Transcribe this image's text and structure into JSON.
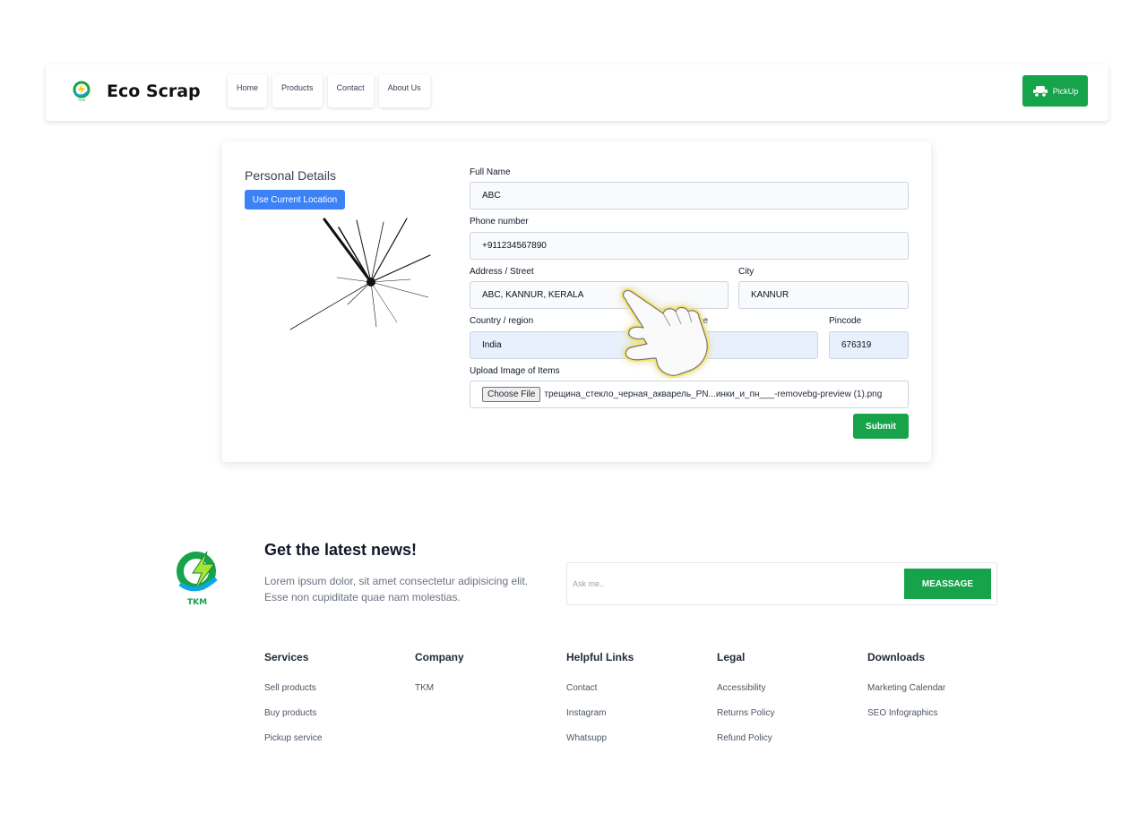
{
  "navbar": {
    "brand": "Eco Scrap",
    "links": [
      "Home",
      "Products",
      "Contact",
      "About Us"
    ],
    "pickup_label": "PickUp"
  },
  "form": {
    "section_title": "Personal Details",
    "location_button": "Use Current Location",
    "full_name": {
      "label": "Full Name",
      "value": "ABC"
    },
    "phone": {
      "label": "Phone number",
      "value": "+911234567890"
    },
    "address": {
      "label": "Address / Street",
      "value": "ABC, KANNUR, KERALA"
    },
    "city": {
      "label": "City",
      "value": "KANNUR"
    },
    "country": {
      "label": "Country / region",
      "value": "India"
    },
    "province": {
      "label": "nce",
      "value": ""
    },
    "pincode": {
      "label": "Pincode",
      "value": "676319"
    },
    "upload": {
      "label": "Upload Image of Items",
      "button": "Choose File",
      "filename": "трещина_стекло_черная_акварель_PN...инки_и_пн___-removebg-preview (1).png"
    },
    "submit_label": "Submit"
  },
  "newsletter": {
    "title": "Get the latest news!",
    "text": "Lorem ipsum dolor, sit amet consectetur adipisicing elit. Esse non cupiditate quae nam molestias.",
    "placeholder": "Ask me..",
    "button": "MEASSAGE",
    "logo_text": "TKM"
  },
  "footer": {
    "columns": [
      {
        "title": "Services",
        "links": [
          "Sell products",
          "Buy products",
          "Pickup service"
        ]
      },
      {
        "title": "Company",
        "links": [
          "TKM"
        ]
      },
      {
        "title": "Helpful Links",
        "links": [
          "Contact",
          "Instagram",
          "Whatsupp"
        ]
      },
      {
        "title": "Legal",
        "links": [
          "Accessibility",
          "Returns Policy",
          "Refund Policy"
        ]
      },
      {
        "title": "Downloads",
        "links": [
          "Marketing Calendar",
          "SEO Infographics"
        ]
      }
    ]
  },
  "colors": {
    "accent_green": "#16a34a",
    "accent_blue": "#3b82f6"
  }
}
